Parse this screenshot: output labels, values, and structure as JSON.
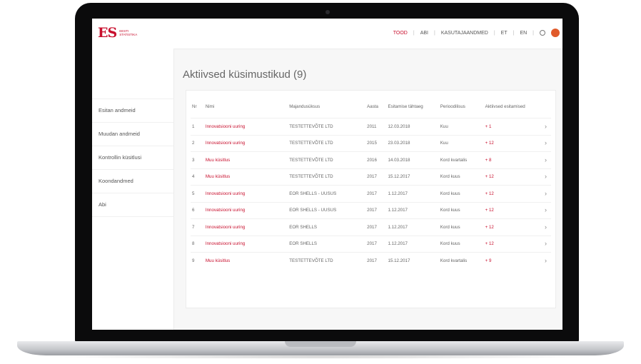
{
  "topnav": {
    "items": [
      "TOOD",
      "ABI",
      "KASUTAJAANDMED",
      "ET",
      "EN"
    ],
    "active": "TOOD"
  },
  "logo": {
    "mark": "ES",
    "text": "EESTI STATISTIKA"
  },
  "sidebar": {
    "items": [
      {
        "label": "Esitan andmeid"
      },
      {
        "label": "Muudan andmeid"
      },
      {
        "label": "Kontrollin küsitlusi"
      },
      {
        "label": "Koondandmed"
      },
      {
        "label": "Abi"
      }
    ]
  },
  "main": {
    "title": "Aktiivsed küsimustikud (9)",
    "columns": [
      "Nr",
      "Nimi",
      "Majandusüksus",
      "Aasta",
      "Esitamise tähtaeg",
      "Perioodilisus",
      "Aktiivsed esitamised"
    ],
    "rows": [
      {
        "nr": "1",
        "name": "Innovatsiooni uuring",
        "unit": "TESTETTEVÕTE LTD",
        "year": "2011",
        "deadline": "12.03.2018",
        "period": "Kuu",
        "active": "+ 1"
      },
      {
        "nr": "2",
        "name": "Innovatsiooni uuring",
        "unit": "TESTETTEVÕTE LTD",
        "year": "2015",
        "deadline": "23.03.2018",
        "period": "Kuu",
        "active": "+ 12"
      },
      {
        "nr": "3",
        "name": "Muu küsitlus",
        "unit": "TESTETTEVÕTE LTD",
        "year": "2016",
        "deadline": "14.03.2018",
        "period": "Kord kvartalis",
        "active": "+ 8"
      },
      {
        "nr": "4",
        "name": "Muu küsitlus",
        "unit": "TESTETTEVÕTE LTD",
        "year": "2017",
        "deadline": "15.12.2017",
        "period": "Kord kuus",
        "active": "+ 12"
      },
      {
        "nr": "5",
        "name": "Innovatsiooni uuring",
        "unit": "EOR SHELLS - UUSUS",
        "year": "2017",
        "deadline": "1.12.2017",
        "period": "Kord kuus",
        "active": "+ 12"
      },
      {
        "nr": "6",
        "name": "Innovatsiooni uuring",
        "unit": "EOR SHELLS - UUSUS",
        "year": "2017",
        "deadline": "1.12.2017",
        "period": "Kord kuus",
        "active": "+ 12"
      },
      {
        "nr": "7",
        "name": "Innovatsiooni uuring",
        "unit": "EOR SHELLS",
        "year": "2017",
        "deadline": "1.12.2017",
        "period": "Kord kuus",
        "active": "+ 12"
      },
      {
        "nr": "8",
        "name": "Innovatsiooni uuring",
        "unit": "EOR SHELLS",
        "year": "2017",
        "deadline": "1.12.2017",
        "period": "Kord kuus",
        "active": "+ 12"
      },
      {
        "nr": "9",
        "name": "Muu küsitlus",
        "unit": "TESTETTEVÕTE LTD",
        "year": "2017",
        "deadline": "15.12.2017",
        "period": "Kord kvartalis",
        "active": "+ 9"
      }
    ]
  },
  "colors": {
    "accent": "#c8102e",
    "bezel": "#0b0b0c",
    "screen_bg": "#f7f7f7"
  },
  "icons": {
    "search": "search-icon",
    "avatar": "avatar",
    "row_action": "chevron-right-icon"
  }
}
